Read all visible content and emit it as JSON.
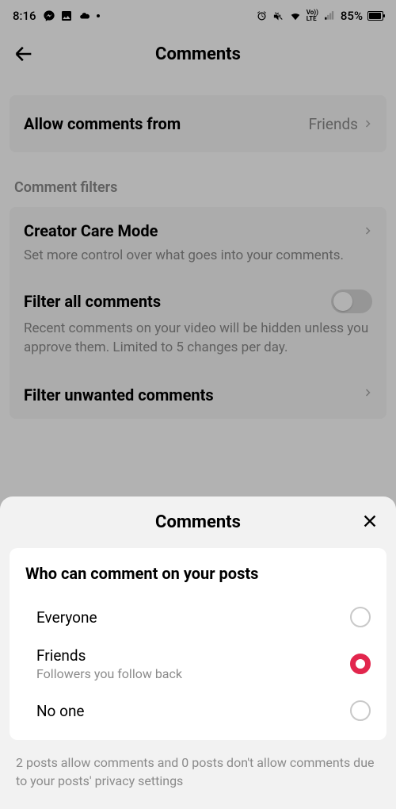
{
  "status": {
    "time": "8:16",
    "battery_pct": "85%"
  },
  "header": {
    "title": "Comments"
  },
  "allow_from": {
    "label": "Allow comments from",
    "value": "Friends"
  },
  "filters_section_label": "Comment filters",
  "creator_care": {
    "title": "Creator Care Mode",
    "desc": "Set more control over what goes into your comments."
  },
  "filter_all": {
    "title": "Filter all comments",
    "desc": "Recent comments on your video will be hidden unless you approve them. Limited to 5 changes per day.",
    "enabled": false
  },
  "filter_unwanted": {
    "title": "Filter unwanted comments"
  },
  "sheet": {
    "title": "Comments",
    "question": "Who can comment on your posts",
    "options": [
      {
        "label": "Everyone",
        "sub": "",
        "selected": false
      },
      {
        "label": "Friends",
        "sub": "Followers you follow back",
        "selected": true
      },
      {
        "label": "No one",
        "sub": "",
        "selected": false
      }
    ],
    "footer": "2 posts allow comments and 0 posts don't allow comments due to your posts' privacy settings"
  }
}
